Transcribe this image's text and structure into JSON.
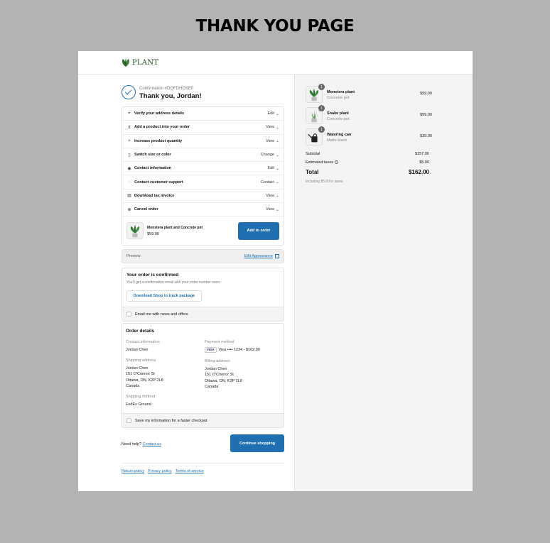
{
  "page_heading": "THANK YOU PAGE",
  "brand": {
    "name": "PLANT",
    "accent": "#1f6fb1",
    "logo_color": "#2e6b2e"
  },
  "confirmation": {
    "number": "Confirmation #DQFDHOSE0",
    "thanks": "Thank you, Jordan!"
  },
  "tasks": [
    {
      "icon": "location-pin-icon",
      "label": "Verify your address details",
      "action": "Edit"
    },
    {
      "icon": "cart-icon",
      "label": "Add a product into your order",
      "action": "View"
    },
    {
      "icon": "plus-icon",
      "label": "Increase product quantity",
      "action": "View"
    },
    {
      "icon": "clipboard-icon",
      "label": "Switch size or color",
      "action": "Change"
    },
    {
      "icon": "user-circle-icon",
      "label": "Contact information",
      "action": "Edit"
    },
    {
      "icon": "chat-icon",
      "label": "Contact customer support",
      "action": "Contact"
    },
    {
      "icon": "invoice-icon",
      "label": "Download tax invoice",
      "action": "View"
    },
    {
      "icon": "cancel-circle-icon",
      "label": "Cancel order",
      "action": "View"
    }
  ],
  "upsell": {
    "name": "Monstera plant and Concrete pot",
    "price": "$59.00",
    "button": "Add to order"
  },
  "preview": {
    "label": "Preview",
    "edit": "Edit Appearance"
  },
  "order_status": {
    "title": "Your order is confirmed",
    "message": "You'll get a confirmation email with your order number soon.",
    "button": "Download Shop to track package",
    "optin": "Email me with news and offers"
  },
  "order_details": {
    "title": "Order details",
    "contact_label": "Contact information",
    "contact_value": "Jordan Chen",
    "payment_label": "Payment method",
    "payment_brand": "VISA",
    "payment_value": "Visa •••• 1234 - $162.00",
    "shipping_label": "Shipping address",
    "shipping_lines": [
      "Jordan Chen",
      "151 O'Connor St",
      "Ottawa, ON, K2P 2L8",
      "Canada"
    ],
    "billing_label": "Billing address",
    "billing_lines": [
      "Jordan Chen",
      "151 O'Connor St",
      "Ottawa, ON, K2P 2L8",
      "Canada"
    ],
    "method_label": "Shipping method",
    "method_value": "FedEx Ground",
    "save_info": "Save my information for a faster checkout"
  },
  "help": {
    "text": "Need help?",
    "link": "Contact us"
  },
  "continue_button": "Continue shopping",
  "footer_links": [
    "Return policy",
    "Privacy policy",
    "Terms of service"
  ],
  "cart": [
    {
      "name": "Monstera plant",
      "variant": "Concrete pot",
      "price": "$59.00",
      "qty": "1",
      "icon": "monstera-plant-icon"
    },
    {
      "name": "Snake plant",
      "variant": "Concrete pot",
      "price": "$59.00",
      "qty": "1",
      "icon": "snake-plant-icon"
    },
    {
      "name": "Watering can",
      "variant": "Matte black",
      "price": "$39.00",
      "qty": "1",
      "icon": "watering-can-icon"
    }
  ],
  "summary": {
    "subtotal_label": "Subtotal",
    "subtotal": "$157.00",
    "taxes_label": "Estimated taxes",
    "taxes": "$5.00",
    "total_label": "Total",
    "total": "$162.00",
    "tax_note": "Including $5.00 in taxes"
  }
}
